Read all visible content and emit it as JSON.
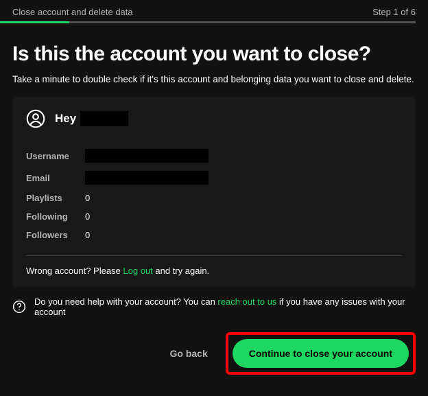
{
  "header": {
    "title": "Close account and delete data",
    "step": "Step 1 of 6"
  },
  "main": {
    "heading": "Is this the account you want to close?",
    "subtitle": "Take a minute to double check if it's this account and belonging data you want to close and delete."
  },
  "card": {
    "greeting_prefix": "Hey",
    "rows": {
      "username_label": "Username",
      "email_label": "Email",
      "playlists_label": "Playlists",
      "playlists_value": "0",
      "following_label": "Following",
      "following_value": "0",
      "followers_label": "Followers",
      "followers_value": "0"
    },
    "wrong_prefix": "Wrong account? Please ",
    "wrong_link": "Log out",
    "wrong_suffix": " and try again."
  },
  "help": {
    "prefix": "Do you need help with your account? You can ",
    "link": "reach out to us",
    "suffix": " if you have any issues with your account"
  },
  "actions": {
    "back": "Go back",
    "continue": "Continue to close your account"
  }
}
